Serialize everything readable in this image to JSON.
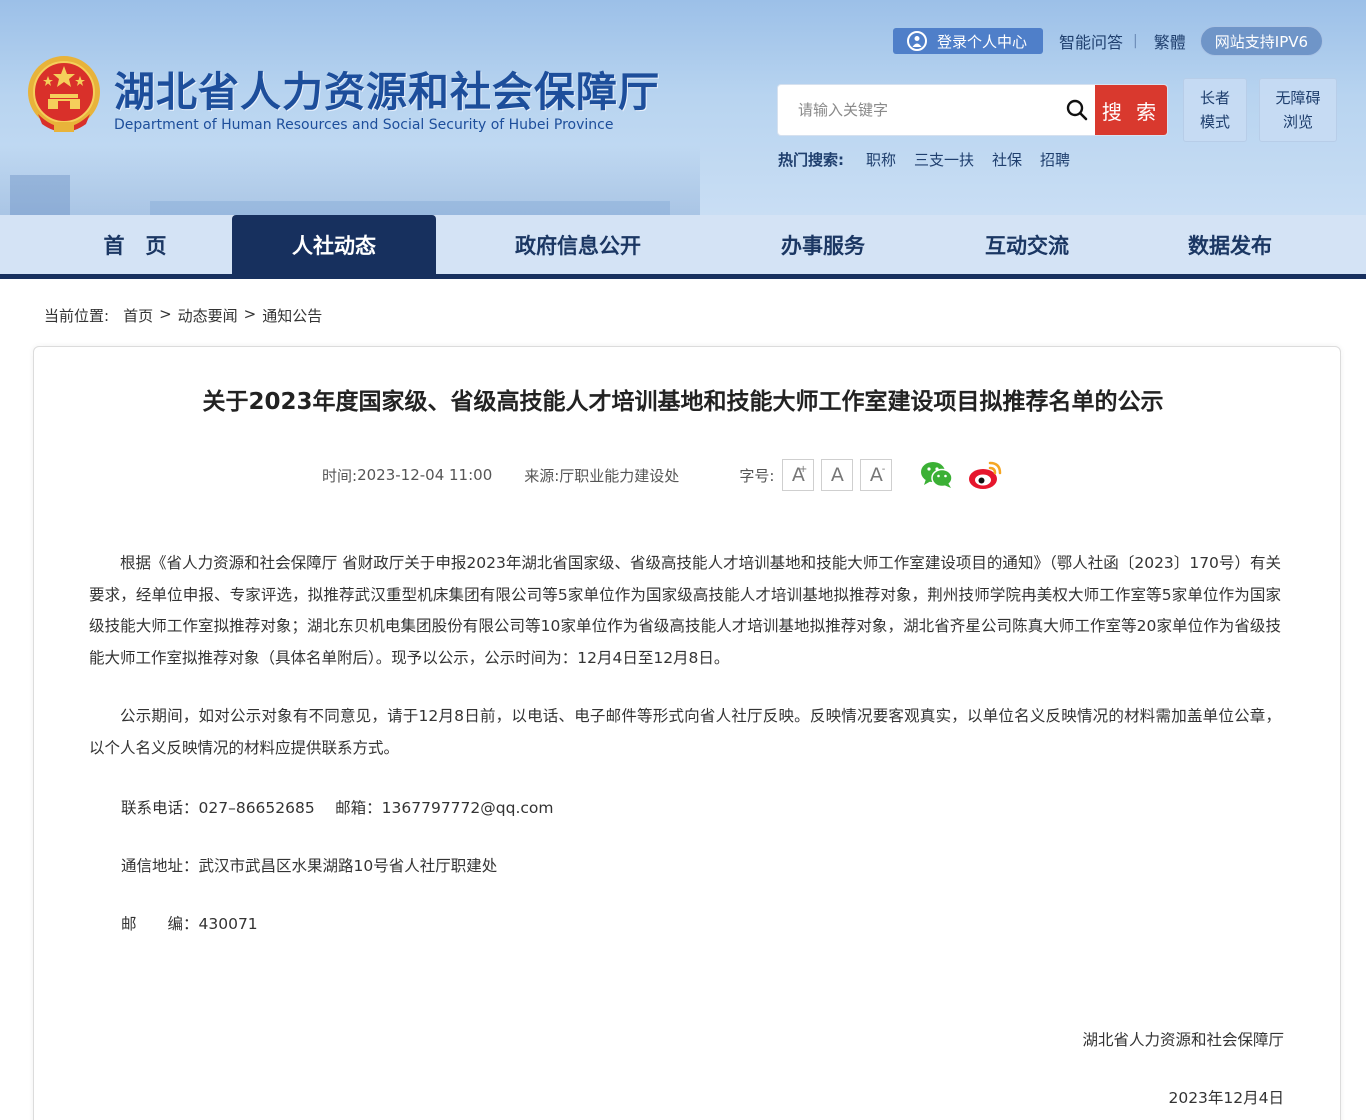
{
  "header": {
    "site_title": "湖北省人力资源和社会保障厅",
    "site_subtitle": "Department of Human Resources and Social Security of Hubei Province",
    "login_label": "登录个人中心",
    "smart_qa": "智能问答",
    "divider": "|",
    "traditional": "繁體",
    "ipv6": "网站支持IPV6",
    "search": {
      "placeholder": "请输入关键字",
      "button": "搜 索"
    },
    "hot_search": {
      "label": "热门搜索:",
      "items": [
        "职称",
        "三支一扶",
        "社保",
        "招聘"
      ]
    },
    "elder_mode": [
      "长者",
      "模式"
    ],
    "accessible": [
      "无障碍",
      "浏览"
    ]
  },
  "nav": {
    "items": [
      "首　页",
      "人社动态",
      "政府信息公开",
      "办事服务",
      "互动交流",
      "数据发布"
    ],
    "active_index": 1
  },
  "breadcrumb": {
    "label": "当前位置:",
    "items": [
      "首页",
      "动态要闻",
      "通知公告"
    ],
    "separator": ">"
  },
  "article": {
    "title": "关于2023年度国家级、省级高技能人才培训基地和技能大师工作室建设项目拟推荐名单的公示",
    "time_label": "时间:",
    "time": "2023-12-04 11:00",
    "source_label": "来源:",
    "source": "厅职业能力建设处",
    "font_size_label": "字号:",
    "font_buttons": [
      "A",
      "A",
      "A"
    ],
    "font_button_marks": [
      "+",
      "",
      "-"
    ],
    "paragraphs": [
      "根据《省人力资源和社会保障厅 省财政厅关于申报2023年湖北省国家级、省级高技能人才培训基地和技能大师工作室建设项目的通知》（鄂人社函〔2023〕170号）有关要求，经单位申报、专家评选，拟推荐武汉重型机床集团有限公司等5家单位作为国家级高技能人才培训基地拟推荐对象，荆州技师学院冉美权大师工作室等5家单位作为国家级技能大师工作室拟推荐对象；湖北东贝机电集团股份有限公司等10家单位作为省级高技能人才培训基地拟推荐对象，湖北省齐星公司陈真大师工作室等20家单位作为省级技能大师工作室拟推荐对象（具体名单附后）。现予以公示，公示时间为：12月4日至12月8日。",
      "公示期间，如对公示对象有不同意见，请于12月8日前，以电话、电子邮件等形式向省人社厅反映。反映情况要客观真实，以单位名义反映情况的材料需加盖单位公章，以个人名义反映情况的材料应提供联系方式。"
    ],
    "contact_phone": "联系电话：027–86652685　 邮箱：1367797772@qq.com",
    "address": "通信地址：武汉市武昌区水果湖路10号省人社厅职建处",
    "postcode": "邮　　编：430071",
    "signature": "湖北省人力资源和社会保障厅",
    "date": "2023年12月4日"
  },
  "colors": {
    "nav_active": "#17305e",
    "search_button": "#d9392e",
    "title_blue": "#1d4e9b"
  },
  "icons": [
    "national-emblem-icon",
    "user-icon",
    "search-icon",
    "wechat-icon",
    "weibo-icon"
  ]
}
